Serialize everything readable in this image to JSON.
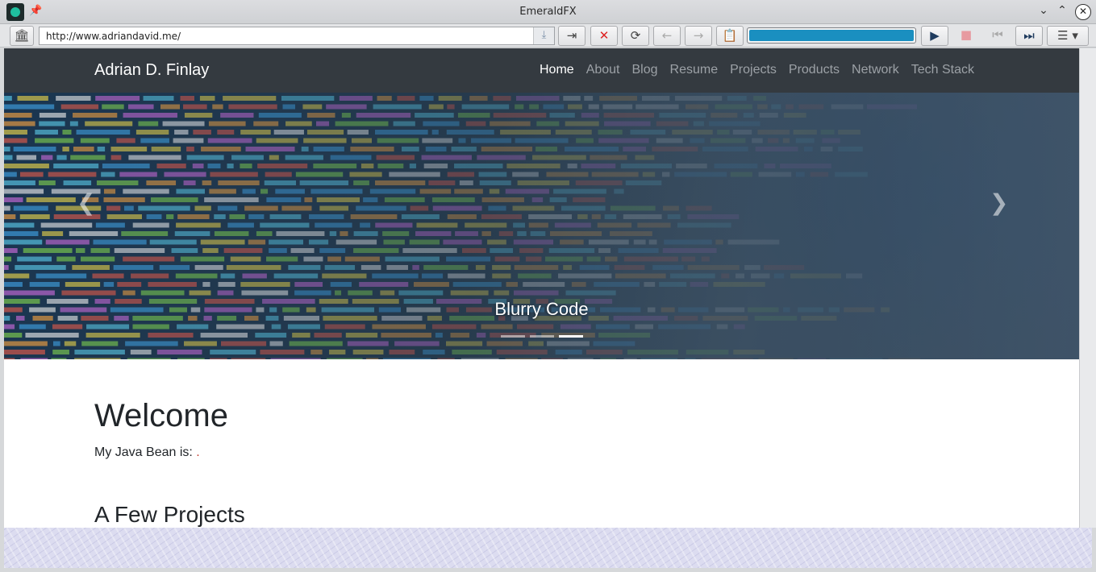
{
  "window": {
    "title": "EmeraldFX"
  },
  "toolbar": {
    "url": "http://www.adriandavid.me/",
    "progress_percent": 100,
    "accent": "#1a8fc0"
  },
  "site": {
    "brand": "Adrian D. Finlay",
    "nav": [
      "Home",
      "About",
      "Blog",
      "Resume",
      "Projects",
      "Products",
      "Network",
      "Tech Stack"
    ],
    "active_nav": "Home",
    "navbar_color": "#343a40"
  },
  "carousel": {
    "caption": "Blurry Code",
    "indicators": 3,
    "active_indicator": 3
  },
  "content": {
    "welcome": "Welcome",
    "bean_label": "My Java Bean is: ",
    "bean_value": ".",
    "projects_heading": "A Few Projects"
  }
}
